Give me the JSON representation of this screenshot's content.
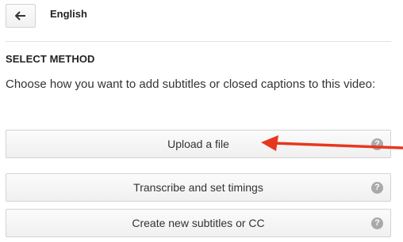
{
  "header": {
    "back_icon": "arrow-left-icon",
    "language": "English"
  },
  "section": {
    "title": "SELECT METHOD",
    "description": "Choose how you want to add subtitles or closed captions to this video:"
  },
  "methods": [
    {
      "label": "Upload a file",
      "help_icon": "question-mark-icon",
      "help_glyph": "?"
    },
    {
      "label": "Transcribe and set timings",
      "help_icon": "question-mark-icon",
      "help_glyph": "?"
    },
    {
      "label": "Create new subtitles or CC",
      "help_icon": "question-mark-icon",
      "help_glyph": "?"
    }
  ],
  "annotation": {
    "arrow_color": "#e8371f",
    "points_to": "Upload a file"
  }
}
